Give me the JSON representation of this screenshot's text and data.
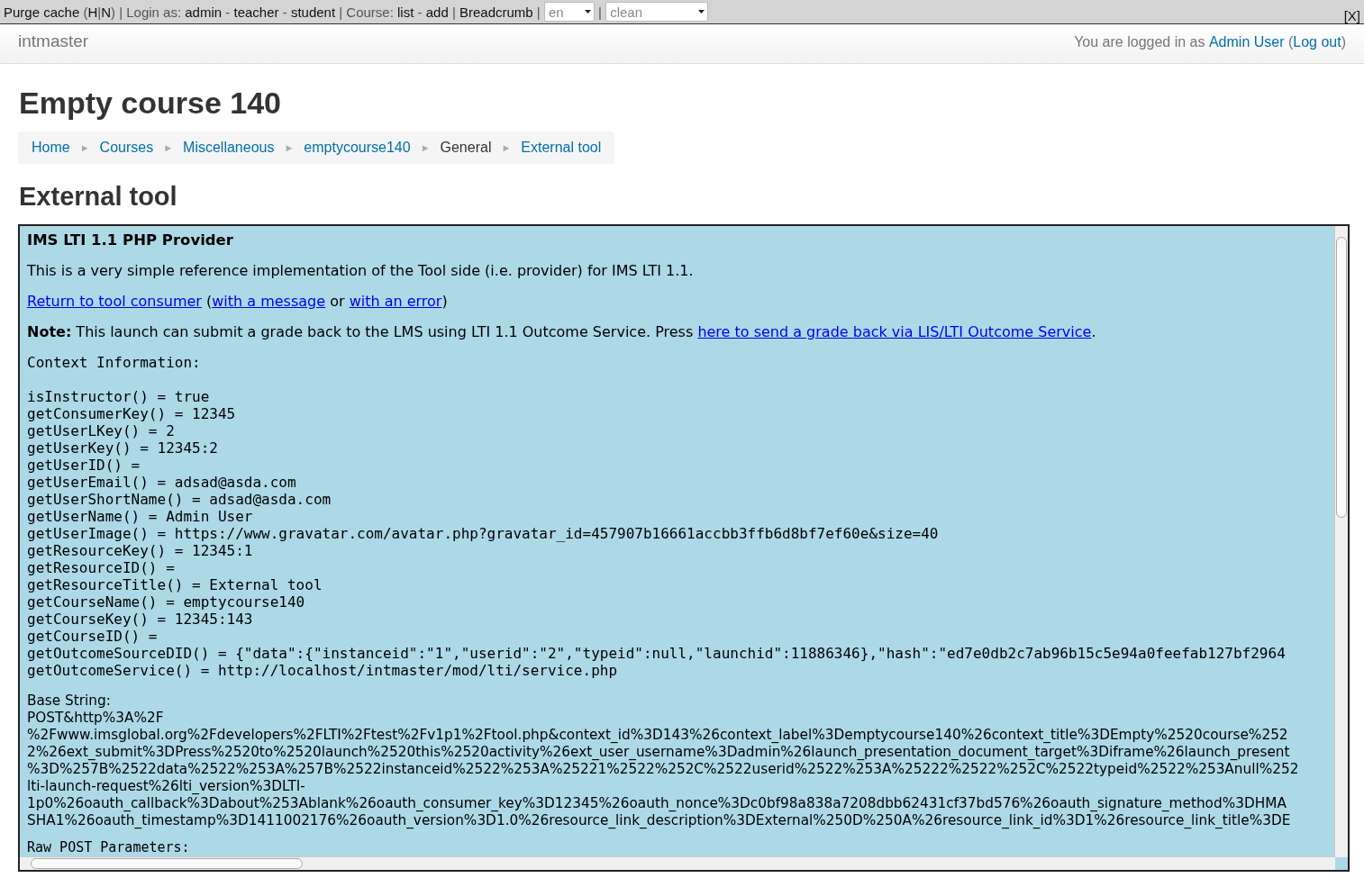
{
  "dev_bar": {
    "items": [
      {
        "kind": "link",
        "text": "Purge cache"
      },
      {
        "kind": "sep",
        "text": " ("
      },
      {
        "kind": "link",
        "text": "H"
      },
      {
        "kind": "sep",
        "text": "|"
      },
      {
        "kind": "link",
        "text": "N"
      },
      {
        "kind": "sep",
        "text": ") | Login as: "
      },
      {
        "kind": "link",
        "text": "admin"
      },
      {
        "kind": "sep",
        "text": " - "
      },
      {
        "kind": "link",
        "text": "teacher"
      },
      {
        "kind": "sep",
        "text": " - "
      },
      {
        "kind": "link",
        "text": "student"
      },
      {
        "kind": "sep",
        "text": " | Course: "
      },
      {
        "kind": "link",
        "text": "list"
      },
      {
        "kind": "sep",
        "text": " - "
      },
      {
        "kind": "link",
        "text": "add"
      },
      {
        "kind": "sep",
        "text": " | "
      },
      {
        "kind": "link",
        "text": "Breadcrumb"
      },
      {
        "kind": "sep",
        "text": " | "
      },
      {
        "kind": "select",
        "text": "en"
      },
      {
        "kind": "sep",
        "text": " | "
      },
      {
        "kind": "select",
        "text": "clean"
      }
    ],
    "close": "[X]"
  },
  "header": {
    "site_name": "intmaster",
    "login_text": "You are logged in as",
    "user": "Admin User",
    "logout_open": "(",
    "logout": "Log out",
    "logout_close": ")"
  },
  "page_title": "Empty course 140",
  "breadcrumb": [
    {
      "label": "Home",
      "link": true
    },
    {
      "label": "Courses",
      "link": true
    },
    {
      "label": "Miscellaneous",
      "link": true
    },
    {
      "label": "emptycourse140",
      "link": true
    },
    {
      "label": "General",
      "link": false
    },
    {
      "label": "External tool",
      "link": true
    }
  ],
  "breadcrumb_separator": "►",
  "section_title": "External tool",
  "frame": {
    "heading": "IMS LTI 1.1 PHP Provider",
    "intro": "This is a very simple reference implementation of the Tool side (i.e. provider) for IMS LTI 1.1.",
    "return_links": [
      {
        "kind": "link",
        "text": "Return to tool consumer"
      },
      {
        "kind": "text",
        "text": " ("
      },
      {
        "kind": "link",
        "text": "with a message"
      },
      {
        "kind": "text",
        "text": " or "
      },
      {
        "kind": "link",
        "text": "with an error"
      },
      {
        "kind": "text",
        "text": ")"
      }
    ],
    "note": "**Note:** This launch can submit a grade back to the LMS using LTI 1.1 Outcome Service. Press",
    "note_link": "here to send a grade back via LIS/LTI Outcome Service",
    "note_end": ".",
    "context_heading": "Context Information:",
    "context_lines": [
      "isInstructor() = true",
      "getConsumerKey() = 12345",
      "getUserLKey() = 2",
      "getUserKey() = 12345:2",
      "getUserID() =",
      "getUserEmail() = adsad@asda.com",
      "getUserShortName() = adsad@asda.com",
      "getUserName() = Admin User",
      "getUserImage() = https://www.gravatar.com/avatar.php?gravatar_id=457907b16661accbb3ffb6d8bf7ef60e&size=40",
      "getResourceKey() = 12345:1",
      "getResourceID() =",
      "getResourceTitle() = External tool",
      "getCourseName() = emptycourse140",
      "getCourseKey() = 12345:143",
      "getCourseID() =",
      "getOutcomeSourceDID() = {\"data\":{\"instanceid\":\"1\",\"userid\":\"2\",\"typeid\":null,\"launchid\":11886346},\"hash\":\"ed7e0db2c7ab96b15c5e94a0feefab127bf2964",
      "getOutcomeService() = http://localhost/intmaster/mod/lti/service.php"
    ],
    "base_heading": "Base String:",
    "base_lines": [
      "POST&http%3A%2F",
      "%2Fwww.imsglobal.org%2Fdevelopers%2FLTI%2Ftest%2Fv1p1%2Ftool.php&context_id%3D143%26context_label%3Demptycourse140%26context_title%3DEmpty%2520course%252",
      "2%26ext_submit%3DPress%2520to%2520launch%2520this%2520activity%26ext_user_username%3Dadmin%26launch_presentation_document_target%3Diframe%26launch_present",
      "%3D%257B%2522data%2522%253A%257B%2522instanceid%2522%253A%25221%2522%252C%2522userid%2522%253A%25222%2522%252C%2522typeid%2522%253Anull%252",
      "lti-launch-request%26lti_version%3DLTI-",
      "1p0%26oauth_callback%3Dabout%253Ablank%26oauth_consumer_key%3D12345%26oauth_nonce%3Dc0bf98a838a7208dbb62431cf37bd576%26oauth_signature_method%3DHMA",
      "SHA1%26oauth_timestamp%3D1411002176%26oauth_version%3D1.0%26resource_link_description%3DExternal%250D%250A%26resource_link_id%3D1%26resource_link_title%3DE"
    ],
    "raw_heading": "Raw POST Parameters:"
  }
}
